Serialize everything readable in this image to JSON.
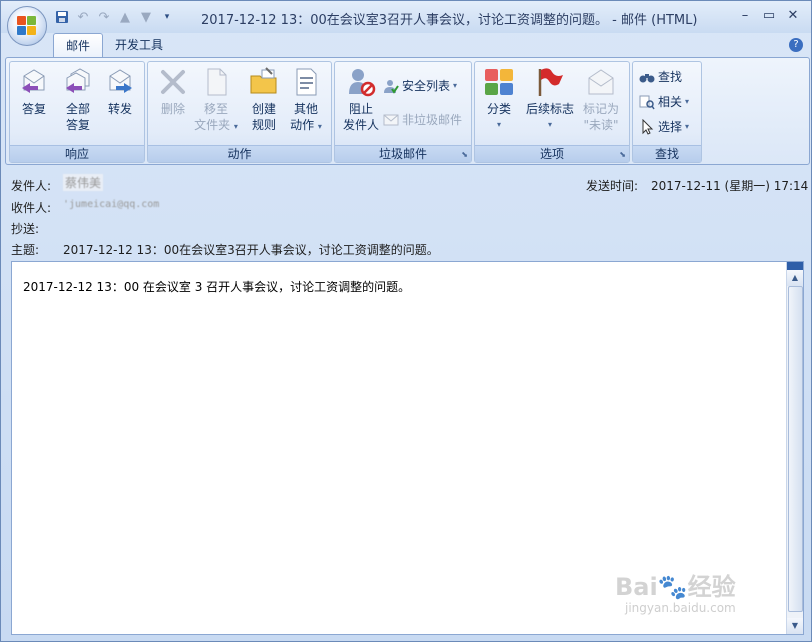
{
  "window": {
    "title": "2017-12-12 13：00在会议室3召开人事会议，讨论工资调整的问题。 - 邮件 (HTML)",
    "controls": [
      "–",
      "▭",
      "✕"
    ]
  },
  "tabs": [
    {
      "label": "邮件",
      "active": true
    },
    {
      "label": "开发工具",
      "active": false
    }
  ],
  "ribbon": {
    "respond": {
      "label": "响应",
      "reply": "答复",
      "reply_all_line1": "全部",
      "reply_all_line2": "答复",
      "forward": "转发"
    },
    "actions": {
      "label": "动作",
      "delete": "删除",
      "move_line1": "移至",
      "move_line2": "文件夹",
      "rules_line1": "创建",
      "rules_line2": "规则",
      "other_line1": "其他",
      "other_line2": "动作"
    },
    "junk": {
      "label": "垃圾邮件",
      "block_line1": "阻止",
      "block_line2": "发件人",
      "safe_lists": "安全列表",
      "not_junk": "非垃圾邮件"
    },
    "options": {
      "label": "选项",
      "categorize": "分类",
      "follow_up": "后续标志",
      "mark_unread_line1": "标记为",
      "mark_unread_line2": "\"未读\""
    },
    "find": {
      "label": "查找",
      "find": "查找",
      "related": "相关",
      "select": "选择"
    }
  },
  "header": {
    "from_label": "发件人:",
    "from_value": "蔡伟美",
    "to_label": "收件人:",
    "to_value": "'jumeicai@qq.com",
    "cc_label": "抄送:",
    "subject_label": "主题:",
    "subject_value": "2017-12-12 13：00在会议室3召开人事会议，讨论工资调整的问题。",
    "sent_label": "发送时间:",
    "sent_value": "2017-12-11 (星期一) 17:14"
  },
  "body": {
    "text": "2017-12-12 13：00 在会议室 3 召开人事会议，讨论工资调整的问题。"
  },
  "watermark": {
    "brand": "Bai🐾经验",
    "url": "jingyan.baidu.com"
  },
  "colors": {
    "ribbon_bg": "#dbe7f7",
    "accent": "#15325e",
    "disabled": "#9aa8bd"
  }
}
